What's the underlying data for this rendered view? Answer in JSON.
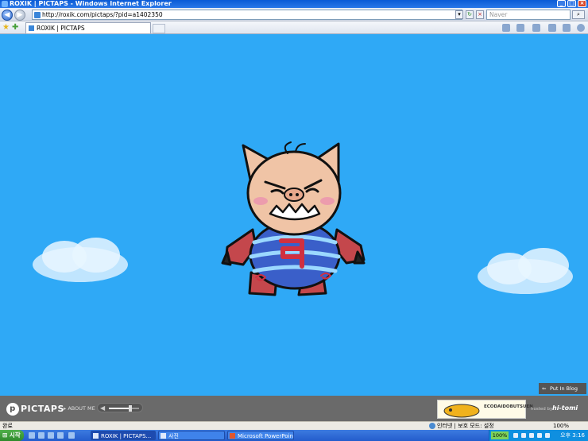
{
  "window": {
    "title": "ROXIK | PICTAPS - Windows Internet Explorer"
  },
  "address_bar": {
    "url": "http://roxik.com/pictaps/?pid=a1402350",
    "search_placeholder": "Naver"
  },
  "tab": {
    "title": "ROXIK | PICTAPS"
  },
  "content": {
    "background": "#2fa9f6",
    "image": "hand-drawn-pig-character"
  },
  "pictaps_bar": {
    "logo": "PICTAPS",
    "about_label": "ABOUT ME",
    "volume_level": 0.7,
    "put_in_blog_label": "Put In Blog",
    "ad_text": "ECODAIDOBUTSUEN",
    "hosted_by_label": "hosted by",
    "host_logo": "hi-tomi"
  },
  "status_bar": {
    "left_text": "완료",
    "zone_text": "인터넷 | 보호 모드: 설정",
    "zoom": "100%"
  },
  "taskbar": {
    "start_label": "시작",
    "tasks": [
      "ROXIK | PICTAPS...",
      "사진",
      "Microsoft PowerPoint..."
    ],
    "tray_percent": "100%",
    "clock": "오후 3:16"
  }
}
